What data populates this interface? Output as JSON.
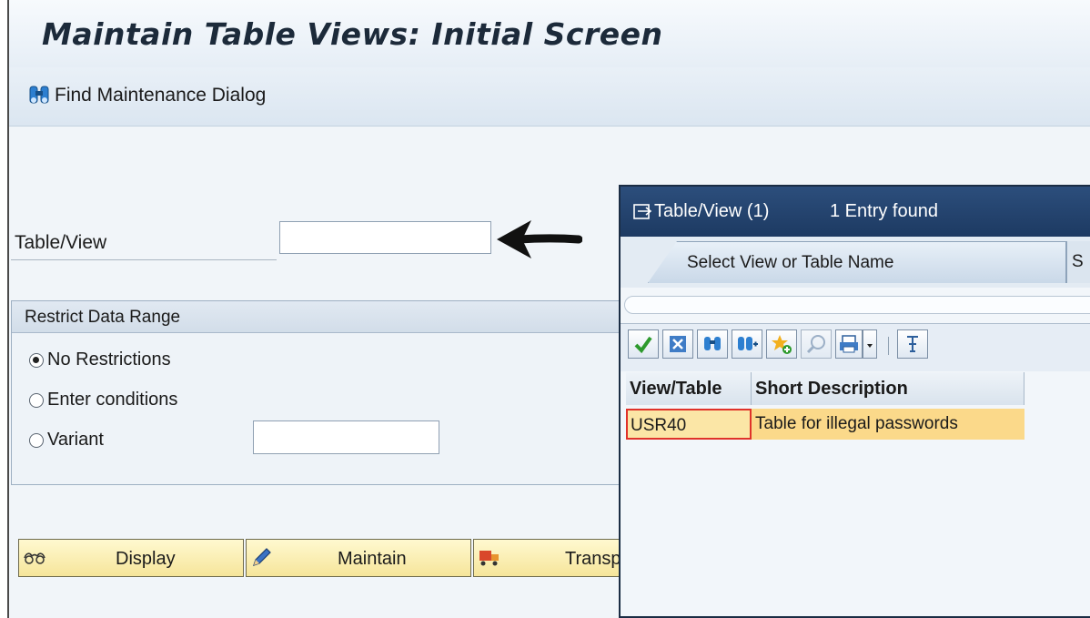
{
  "window": {
    "title": "Maintain Table Views: Initial Screen",
    "toolbar": {
      "find_label": "Find Maintenance Dialog"
    }
  },
  "form": {
    "table_view_label": "Table/View",
    "table_view_value": "",
    "restrict": {
      "title": "Restrict Data Range",
      "options": [
        "No Restrictions",
        "Enter conditions",
        "Variant"
      ],
      "selected": "No Restrictions",
      "variant_value": ""
    }
  },
  "actions": {
    "display": "Display",
    "maintain": "Maintain",
    "transport": "Transp"
  },
  "popup": {
    "title": "Table/View (1)",
    "count": "1 Entry found",
    "tab_active": "Select View or Table Name",
    "tab_next": "S",
    "columns": [
      "View/Table",
      "Short Description"
    ],
    "rows": [
      {
        "view_table": "USR40",
        "description": "Table for illegal passwords"
      }
    ]
  },
  "colors": {
    "accent_title": "#1d3a62",
    "highlight_row": "#fbd98a",
    "selected_cell_border": "#e0322a",
    "button_yellow": "#f6e59a"
  }
}
